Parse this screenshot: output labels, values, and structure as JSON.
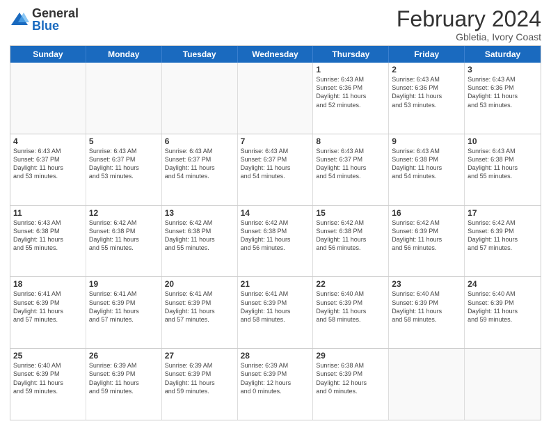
{
  "logo": {
    "general": "General",
    "blue": "Blue"
  },
  "title": "February 2024",
  "subtitle": "Gbletia, Ivory Coast",
  "days": [
    "Sunday",
    "Monday",
    "Tuesday",
    "Wednesday",
    "Thursday",
    "Friday",
    "Saturday"
  ],
  "weeks": [
    [
      {
        "day": "",
        "info": ""
      },
      {
        "day": "",
        "info": ""
      },
      {
        "day": "",
        "info": ""
      },
      {
        "day": "",
        "info": ""
      },
      {
        "day": "1",
        "info": "Sunrise: 6:43 AM\nSunset: 6:36 PM\nDaylight: 11 hours\nand 52 minutes."
      },
      {
        "day": "2",
        "info": "Sunrise: 6:43 AM\nSunset: 6:36 PM\nDaylight: 11 hours\nand 53 minutes."
      },
      {
        "day": "3",
        "info": "Sunrise: 6:43 AM\nSunset: 6:36 PM\nDaylight: 11 hours\nand 53 minutes."
      }
    ],
    [
      {
        "day": "4",
        "info": "Sunrise: 6:43 AM\nSunset: 6:37 PM\nDaylight: 11 hours\nand 53 minutes."
      },
      {
        "day": "5",
        "info": "Sunrise: 6:43 AM\nSunset: 6:37 PM\nDaylight: 11 hours\nand 53 minutes."
      },
      {
        "day": "6",
        "info": "Sunrise: 6:43 AM\nSunset: 6:37 PM\nDaylight: 11 hours\nand 54 minutes."
      },
      {
        "day": "7",
        "info": "Sunrise: 6:43 AM\nSunset: 6:37 PM\nDaylight: 11 hours\nand 54 minutes."
      },
      {
        "day": "8",
        "info": "Sunrise: 6:43 AM\nSunset: 6:37 PM\nDaylight: 11 hours\nand 54 minutes."
      },
      {
        "day": "9",
        "info": "Sunrise: 6:43 AM\nSunset: 6:38 PM\nDaylight: 11 hours\nand 54 minutes."
      },
      {
        "day": "10",
        "info": "Sunrise: 6:43 AM\nSunset: 6:38 PM\nDaylight: 11 hours\nand 55 minutes."
      }
    ],
    [
      {
        "day": "11",
        "info": "Sunrise: 6:43 AM\nSunset: 6:38 PM\nDaylight: 11 hours\nand 55 minutes."
      },
      {
        "day": "12",
        "info": "Sunrise: 6:42 AM\nSunset: 6:38 PM\nDaylight: 11 hours\nand 55 minutes."
      },
      {
        "day": "13",
        "info": "Sunrise: 6:42 AM\nSunset: 6:38 PM\nDaylight: 11 hours\nand 55 minutes."
      },
      {
        "day": "14",
        "info": "Sunrise: 6:42 AM\nSunset: 6:38 PM\nDaylight: 11 hours\nand 56 minutes."
      },
      {
        "day": "15",
        "info": "Sunrise: 6:42 AM\nSunset: 6:38 PM\nDaylight: 11 hours\nand 56 minutes."
      },
      {
        "day": "16",
        "info": "Sunrise: 6:42 AM\nSunset: 6:39 PM\nDaylight: 11 hours\nand 56 minutes."
      },
      {
        "day": "17",
        "info": "Sunrise: 6:42 AM\nSunset: 6:39 PM\nDaylight: 11 hours\nand 57 minutes."
      }
    ],
    [
      {
        "day": "18",
        "info": "Sunrise: 6:41 AM\nSunset: 6:39 PM\nDaylight: 11 hours\nand 57 minutes."
      },
      {
        "day": "19",
        "info": "Sunrise: 6:41 AM\nSunset: 6:39 PM\nDaylight: 11 hours\nand 57 minutes."
      },
      {
        "day": "20",
        "info": "Sunrise: 6:41 AM\nSunset: 6:39 PM\nDaylight: 11 hours\nand 57 minutes."
      },
      {
        "day": "21",
        "info": "Sunrise: 6:41 AM\nSunset: 6:39 PM\nDaylight: 11 hours\nand 58 minutes."
      },
      {
        "day": "22",
        "info": "Sunrise: 6:40 AM\nSunset: 6:39 PM\nDaylight: 11 hours\nand 58 minutes."
      },
      {
        "day": "23",
        "info": "Sunrise: 6:40 AM\nSunset: 6:39 PM\nDaylight: 11 hours\nand 58 minutes."
      },
      {
        "day": "24",
        "info": "Sunrise: 6:40 AM\nSunset: 6:39 PM\nDaylight: 11 hours\nand 59 minutes."
      }
    ],
    [
      {
        "day": "25",
        "info": "Sunrise: 6:40 AM\nSunset: 6:39 PM\nDaylight: 11 hours\nand 59 minutes."
      },
      {
        "day": "26",
        "info": "Sunrise: 6:39 AM\nSunset: 6:39 PM\nDaylight: 11 hours\nand 59 minutes."
      },
      {
        "day": "27",
        "info": "Sunrise: 6:39 AM\nSunset: 6:39 PM\nDaylight: 11 hours\nand 59 minutes."
      },
      {
        "day": "28",
        "info": "Sunrise: 6:39 AM\nSunset: 6:39 PM\nDaylight: 12 hours\nand 0 minutes."
      },
      {
        "day": "29",
        "info": "Sunrise: 6:38 AM\nSunset: 6:39 PM\nDaylight: 12 hours\nand 0 minutes."
      },
      {
        "day": "",
        "info": ""
      },
      {
        "day": "",
        "info": ""
      }
    ]
  ]
}
